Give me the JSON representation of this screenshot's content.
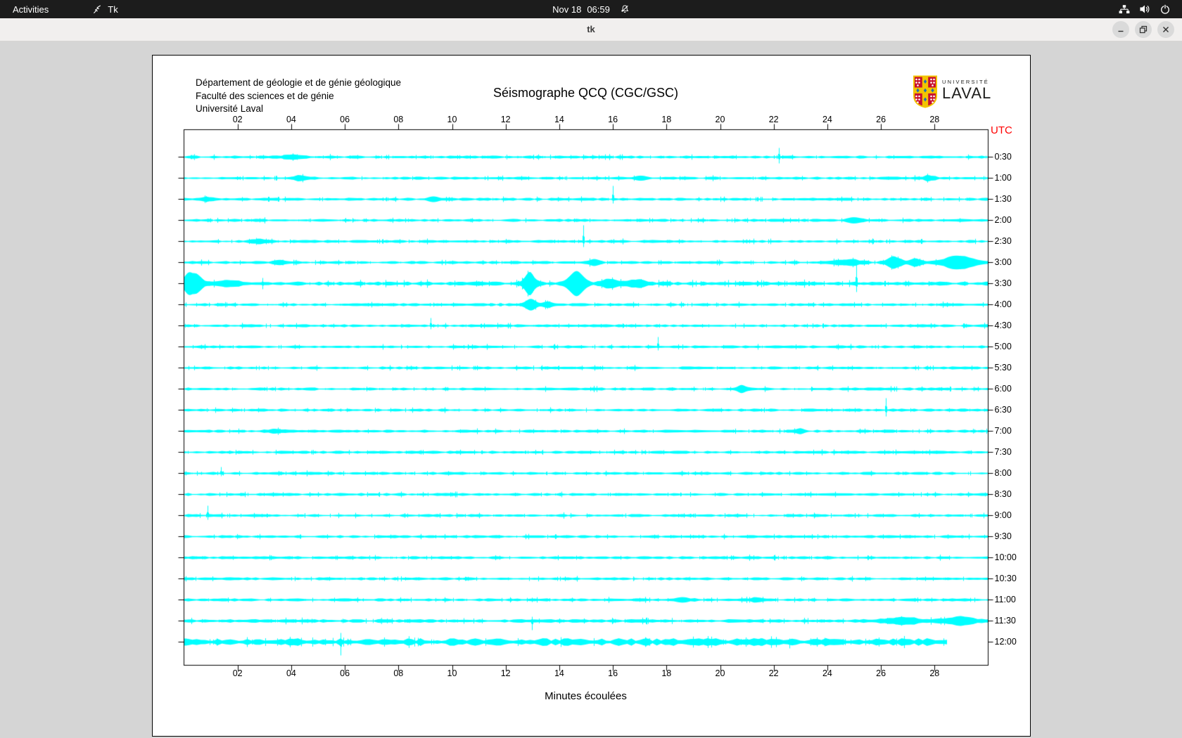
{
  "topbar": {
    "activities": "Activities",
    "app_name": "Tk",
    "clock_date": "Nov 18",
    "clock_time": "06:59"
  },
  "window": {
    "title": "tk"
  },
  "header": {
    "lines": [
      "Département de géologie et de génie géologique",
      "Faculté des sciences et de génie",
      "Université Laval"
    ],
    "title": "Séismographe QCQ (CGC/GSC)",
    "logo": {
      "univ": "UNIVERSITÉ",
      "laval": "LAVAL"
    }
  },
  "colors": {
    "topbar_bg": "#1c1c1c",
    "titlebar_bg": "#f1efee",
    "body_bg": "#d5d5d5",
    "canvas_bg": "#ffffff",
    "frame": "#000000",
    "trace": "#00ffff",
    "utc": "#ff0000"
  },
  "chart_data": {
    "type": "line",
    "title": "Séismographe QCQ (CGC/GSC)",
    "xlabel": "Minutes écoulées",
    "utc_label": "UTC",
    "x_ticks": [
      "02",
      "04",
      "06",
      "08",
      "10",
      "12",
      "14",
      "16",
      "18",
      "20",
      "22",
      "24",
      "26",
      "28"
    ],
    "x_range_minutes": [
      0,
      30
    ],
    "minutes_per_row": 30,
    "trace_color": "#00ffff",
    "rows": [
      {
        "label": "0:30",
        "bursts": [
          {
            "m": 4.0,
            "w": 0.5,
            "a": 2.5
          }
        ],
        "spikes": [
          {
            "m": 22.2,
            "a": 13,
            "d": 9
          }
        ]
      },
      {
        "label": "1:00",
        "bursts": [
          {
            "m": 4.3,
            "w": 0.5,
            "a": 2.5
          },
          {
            "m": 17.0,
            "w": 0.4,
            "a": 2.2
          },
          {
            "m": 27.8,
            "w": 0.35,
            "a": 3.0
          }
        ]
      },
      {
        "label": "1:30",
        "bursts": [
          {
            "m": 0.9,
            "w": 0.3,
            "a": 2.2
          },
          {
            "m": 9.3,
            "w": 0.3,
            "a": 2.0
          }
        ],
        "spikes": [
          {
            "m": 16.0,
            "a": 19,
            "d": 6
          }
        ]
      },
      {
        "label": "2:00",
        "bursts": [
          {
            "m": 25.0,
            "w": 0.4,
            "a": 2.8
          }
        ]
      },
      {
        "label": "2:30",
        "bursts": [
          {
            "m": 2.8,
            "w": 0.5,
            "a": 2.4
          }
        ],
        "spikes": [
          {
            "m": 14.9,
            "a": 23,
            "d": 8
          }
        ]
      },
      {
        "label": "3:00",
        "bursts": [
          {
            "m": 3.6,
            "w": 0.4,
            "a": 2.6
          },
          {
            "m": 15.3,
            "w": 0.3,
            "a": 3.0
          },
          {
            "m": 24.8,
            "w": 0.7,
            "a": 3.5
          },
          {
            "m": 26.5,
            "w": 0.45,
            "a": 7.0
          },
          {
            "m": 27.3,
            "w": 0.35,
            "a": 4.5
          },
          {
            "m": 28.9,
            "w": 1.0,
            "a": 8.0
          }
        ]
      },
      {
        "label": "3:30",
        "base": 1.7,
        "bursts": [
          {
            "m": 0.15,
            "w": 0.25,
            "a": 7.0
          },
          {
            "m": 0.4,
            "w": 0.45,
            "a": 12.0
          },
          {
            "m": 1.6,
            "w": 0.7,
            "a": 3.5
          },
          {
            "m": 12.9,
            "w": 0.32,
            "a": 14.0
          },
          {
            "m": 14.65,
            "w": 0.45,
            "a": 16.0
          },
          {
            "m": 15.9,
            "w": 0.5,
            "a": 5.0
          },
          {
            "m": 16.9,
            "w": 0.55,
            "a": 4.5
          }
        ],
        "spikes": [
          {
            "m": 2.95,
            "a": 8,
            "d": 8
          },
          {
            "m": 25.1,
            "a": 27,
            "d": 12
          }
        ]
      },
      {
        "label": "4:00",
        "bursts": [
          {
            "m": 12.95,
            "w": 0.35,
            "a": 7.0
          },
          {
            "m": 13.55,
            "w": 0.3,
            "a": 3.5
          }
        ]
      },
      {
        "label": "4:30",
        "spikes": [
          {
            "m": 9.2,
            "a": 11,
            "d": 5
          }
        ]
      },
      {
        "label": "5:00",
        "spikes": [
          {
            "m": 17.7,
            "a": 14,
            "d": 5
          }
        ]
      },
      {
        "label": "5:30"
      },
      {
        "label": "6:00",
        "bursts": [
          {
            "m": 20.8,
            "w": 0.28,
            "a": 3.8
          }
        ]
      },
      {
        "label": "6:30",
        "spikes": [
          {
            "m": 26.2,
            "a": 17,
            "d": 9
          }
        ]
      },
      {
        "label": "7:00",
        "bursts": [
          {
            "m": 3.4,
            "w": 0.4,
            "a": 2.6
          },
          {
            "m": 23.0,
            "w": 0.3,
            "a": 2.2
          }
        ]
      },
      {
        "label": "7:30"
      },
      {
        "label": "8:00",
        "spikes": [
          {
            "m": 1.4,
            "a": 9,
            "d": 4
          }
        ]
      },
      {
        "label": "8:30"
      },
      {
        "label": "9:00",
        "spikes": [
          {
            "m": 0.9,
            "a": 14,
            "d": 6
          }
        ]
      },
      {
        "label": "9:30"
      },
      {
        "label": "10:00"
      },
      {
        "label": "10:30"
      },
      {
        "label": "11:00",
        "bursts": [
          {
            "m": 18.6,
            "w": 0.5,
            "a": 2.2
          },
          {
            "m": 21.4,
            "w": 0.4,
            "a": 2.2
          }
        ]
      },
      {
        "label": "11:30",
        "base": 1.5,
        "bursts": [
          {
            "m": 26.8,
            "w": 1.2,
            "a": 3.5
          },
          {
            "m": 29.0,
            "w": 0.9,
            "a": 4.5
          }
        ],
        "spikes": [
          {
            "m": 13.0,
            "a": 6,
            "d": 13
          }
        ]
      },
      {
        "label": "12:00",
        "base": 3.2,
        "end_min": 28.5,
        "spikes": [
          {
            "m": 2.35,
            "a": 7,
            "d": 7
          },
          {
            "m": 5.85,
            "a": 13,
            "d": 19
          },
          {
            "m": 22.6,
            "a": 5,
            "d": 9
          }
        ]
      }
    ]
  }
}
